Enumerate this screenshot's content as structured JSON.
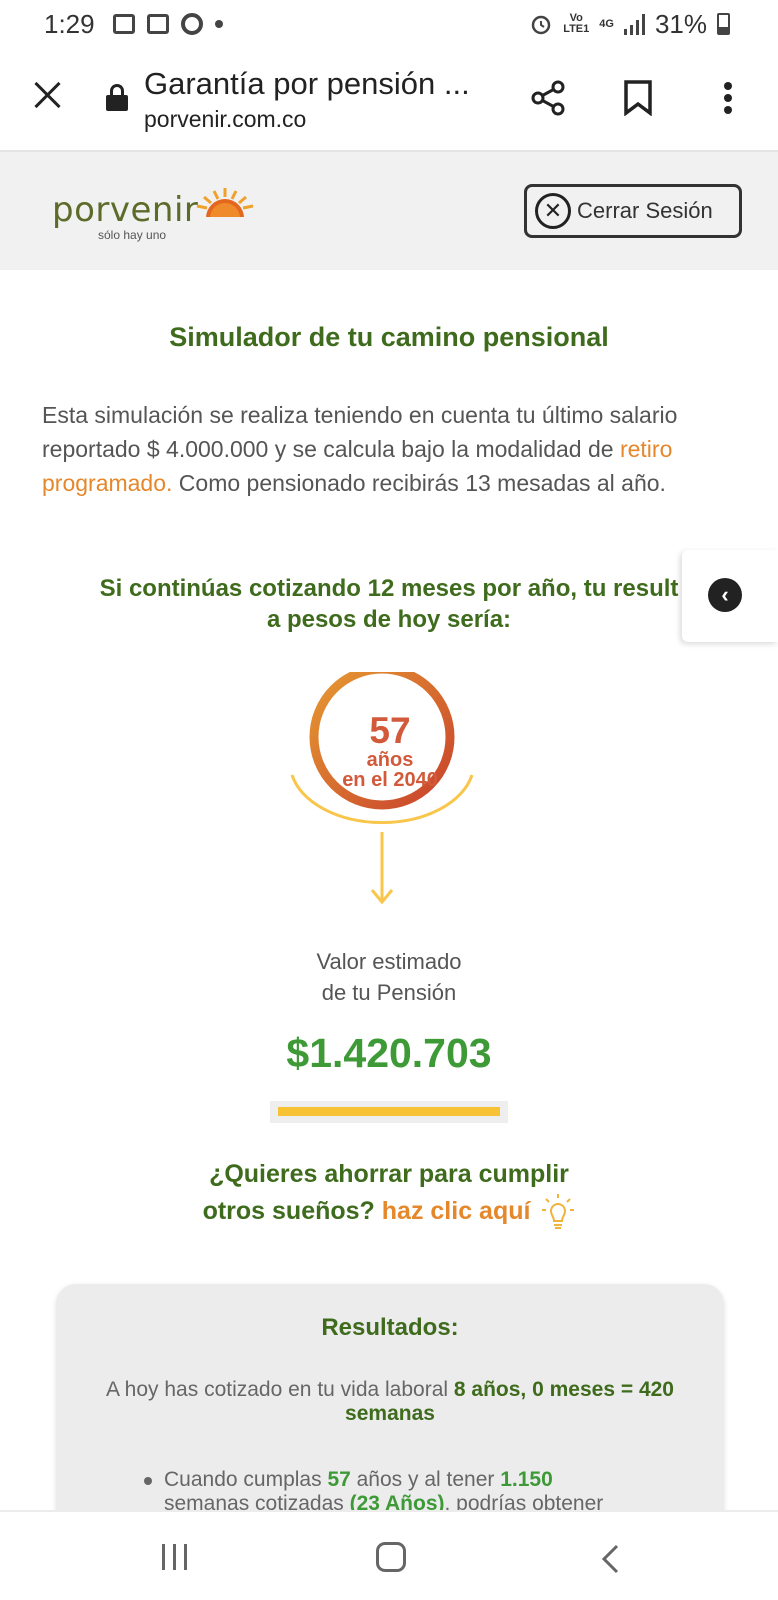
{
  "status_bar": {
    "time": "1:29",
    "network_vo": "Vo",
    "network_lte": "LTE1",
    "network_gen": "4G",
    "battery": "31%"
  },
  "browser": {
    "page_title": "Garantía por pensión ...",
    "domain": "porvenir.com.co",
    "icons": [
      "close-icon",
      "lock-icon",
      "share-icon",
      "bookmark-icon",
      "more-vert-icon"
    ]
  },
  "header": {
    "logo_text": "porvenir",
    "logo_tagline": "sólo hay uno",
    "logout_label": "Cerrar Sesión",
    "brand_color": "#5d6b2a"
  },
  "main": {
    "title": "Simulador de tu camino pensional",
    "desc_part1": "Esta simulación se realiza teniendo en cuenta tu último salario reportado $ 4.000.000 y se calcula bajo la modalidad de ",
    "desc_link": "retiro programado.",
    "desc_part2": " Como pensionado recibirás 13 mesadas al año.",
    "subhead_line1": "Si continúas cotizando 12 meses por año, tu result",
    "subhead_line2": "a pesos de hoy sería:",
    "gauge_age": "57",
    "gauge_label1": "años",
    "gauge_label2": "en el 2040",
    "valor_label_line1": "Valor estimado",
    "valor_label_line2": "de tu Pensión",
    "valor_amount": "$1.420.703",
    "ahorro_line1": "¿Quieres ahorrar para cumplir",
    "ahorro_line2": "otros sueños?",
    "ahorro_link": "haz clic aquí"
  },
  "results": {
    "title": "Resultados:",
    "line_prefix": "A hoy has cotizado en tu vida laboral ",
    "line_highlight": "8 años, 0 meses = 420 semanas",
    "bullet_prefix": "Cuando cumplas ",
    "bullet_age": "57",
    "bullet_mid": " años y al tener ",
    "bullet_weeks": "1.150",
    "bullet_weeks_label": "semanas cotizadas ",
    "bullet_years": "(23 Años)",
    "bullet_suffix": ", podrías obtener"
  },
  "colors": {
    "accent_green": "#3f6b1d",
    "amount_green": "#3d9a36",
    "orange": "#e5872b",
    "gauge_red": "#d25a3a",
    "bar_yellow": "#f7c234"
  }
}
